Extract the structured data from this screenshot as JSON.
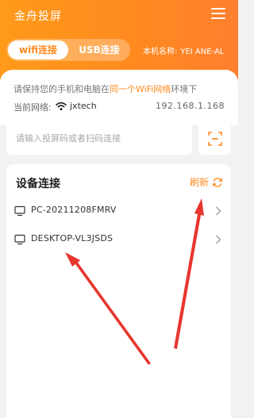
{
  "app": {
    "title": "金舟投屏"
  },
  "tabs": [
    {
      "label": "wifi连接",
      "active": true
    },
    {
      "label": "USB连接",
      "active": false
    }
  ],
  "device": {
    "name_label": "本机名称:",
    "name_value": "YEI  ANE-AL"
  },
  "notice": {
    "prefix": "请保持您的手机和电脑在",
    "highlight": "同一个WiFi网络",
    "suffix": "环境下"
  },
  "network": {
    "label": "当前网络:",
    "name": "jxtech",
    "ip": "192.168.1.168"
  },
  "search": {
    "placeholder": "请输入投屏码或者扫码连接"
  },
  "devices": {
    "title": "设备连接",
    "refresh_label": "刷新",
    "items": [
      {
        "name": "PC-20211208FMRV"
      },
      {
        "name": "DESKTOP-VL3JSDS"
      }
    ]
  },
  "colors": {
    "accent": "#ff8a1f",
    "annotation_arrow": "#e8362e"
  },
  "icons": [
    "menu-icon",
    "wifi-icon",
    "scan-icon",
    "refresh-icon",
    "computer-icon",
    "chevron-right-icon"
  ]
}
